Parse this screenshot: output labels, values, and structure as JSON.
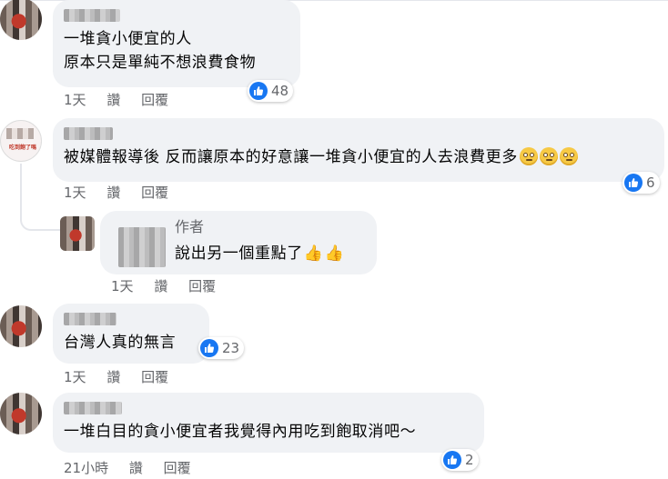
{
  "comments": [
    {
      "text_lines": [
        "一堆貪小便宜的人",
        "原本只是單純不想浪費食物"
      ],
      "time": "1天",
      "like": "讚",
      "reply": "回覆",
      "reactions": "48"
    },
    {
      "text": "被媒體報導後 反而讓原本的好意讓一堆貪小便宜的人去浪費更多",
      "avatar_logo_text": "吃到飽了嗎",
      "time": "1天",
      "like": "讚",
      "reply": "回覆",
      "reactions": "6",
      "reply_comment": {
        "author_label": "作者",
        "text": "說出另一個重點了",
        "time": "1天",
        "like": "讚",
        "reply": "回覆"
      }
    },
    {
      "text": "台灣人真的無言",
      "time": "1天",
      "like": "讚",
      "reply": "回覆",
      "reactions": "23"
    },
    {
      "text": "一堆白目的貪小便宜者我覺得內用吃到飽取消吧～",
      "time": "21小時",
      "like": "讚",
      "reply": "回覆",
      "reactions": "2"
    }
  ],
  "icons": {
    "like": "like-icon",
    "eye_roll": "eye-roll-emoji-icon",
    "thumbs_up": "thumbs-up-emoji-icon"
  },
  "colors": {
    "bubble": "#f0f2f5",
    "like_blue": "#1877f2",
    "meta_text": "#65676b"
  }
}
